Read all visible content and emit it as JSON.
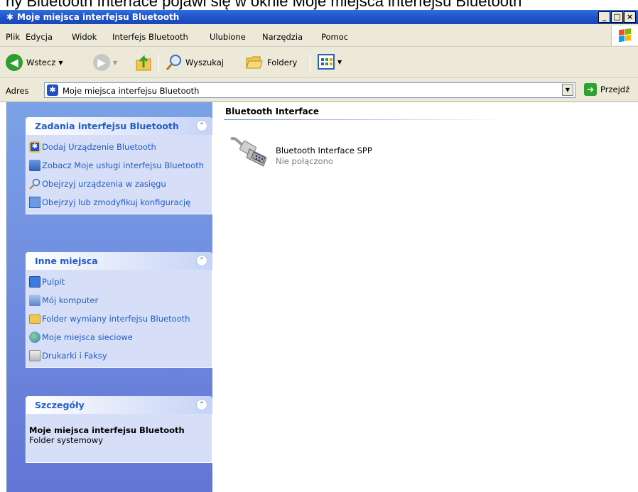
{
  "top_caption": "ny Bluetooth Interface pojawi się w oknie Moje miejsca interfejsu Bluetooth",
  "window": {
    "title": "Moje miejsca interfejsu Bluetooth",
    "buttons": [
      "_",
      "□",
      "×"
    ]
  },
  "menu": [
    "Plik",
    "Edycja",
    "Widok",
    "Interfejs Bluetooth",
    "Ulubione",
    "Narzędzia",
    "Pomoc"
  ],
  "toolbar": {
    "back_label": "Wstecz",
    "search_label": "Wyszukaj",
    "folders_label": "Foldery"
  },
  "address": {
    "label": "Adres",
    "value": "Moje miejsca interfejsu Bluetooth",
    "go_label": "Przejdź"
  },
  "task_pane": {
    "tasks": {
      "title": "Zadania interfejsu Bluetooth",
      "links": [
        "Dodaj Urządzenie Bluetooth",
        "Zobacz Moje usługi interfejsu Bluetooth",
        "Obejrzyj urządzenia w zasięgu",
        "Obejrzyj lub zmodyfikuj konfigurację"
      ]
    },
    "other_places": {
      "title": "Inne miejsca",
      "links": [
        "Pulpit",
        "Mój komputer",
        "Folder wymiany interfejsu Bluetooth",
        "Moje miejsca sieciowe",
        "Drukarki i Faksy"
      ]
    },
    "details": {
      "title": "Szczegóły",
      "name": "Moje miejsca interfejsu Bluetooth",
      "type": "Folder systemowy"
    }
  },
  "content": {
    "group_header": "Bluetooth Interface",
    "items": [
      {
        "name": "Bluetooth Interface SPP",
        "status": "Nie połączono",
        "icon": "serial-cable-icon"
      }
    ]
  }
}
